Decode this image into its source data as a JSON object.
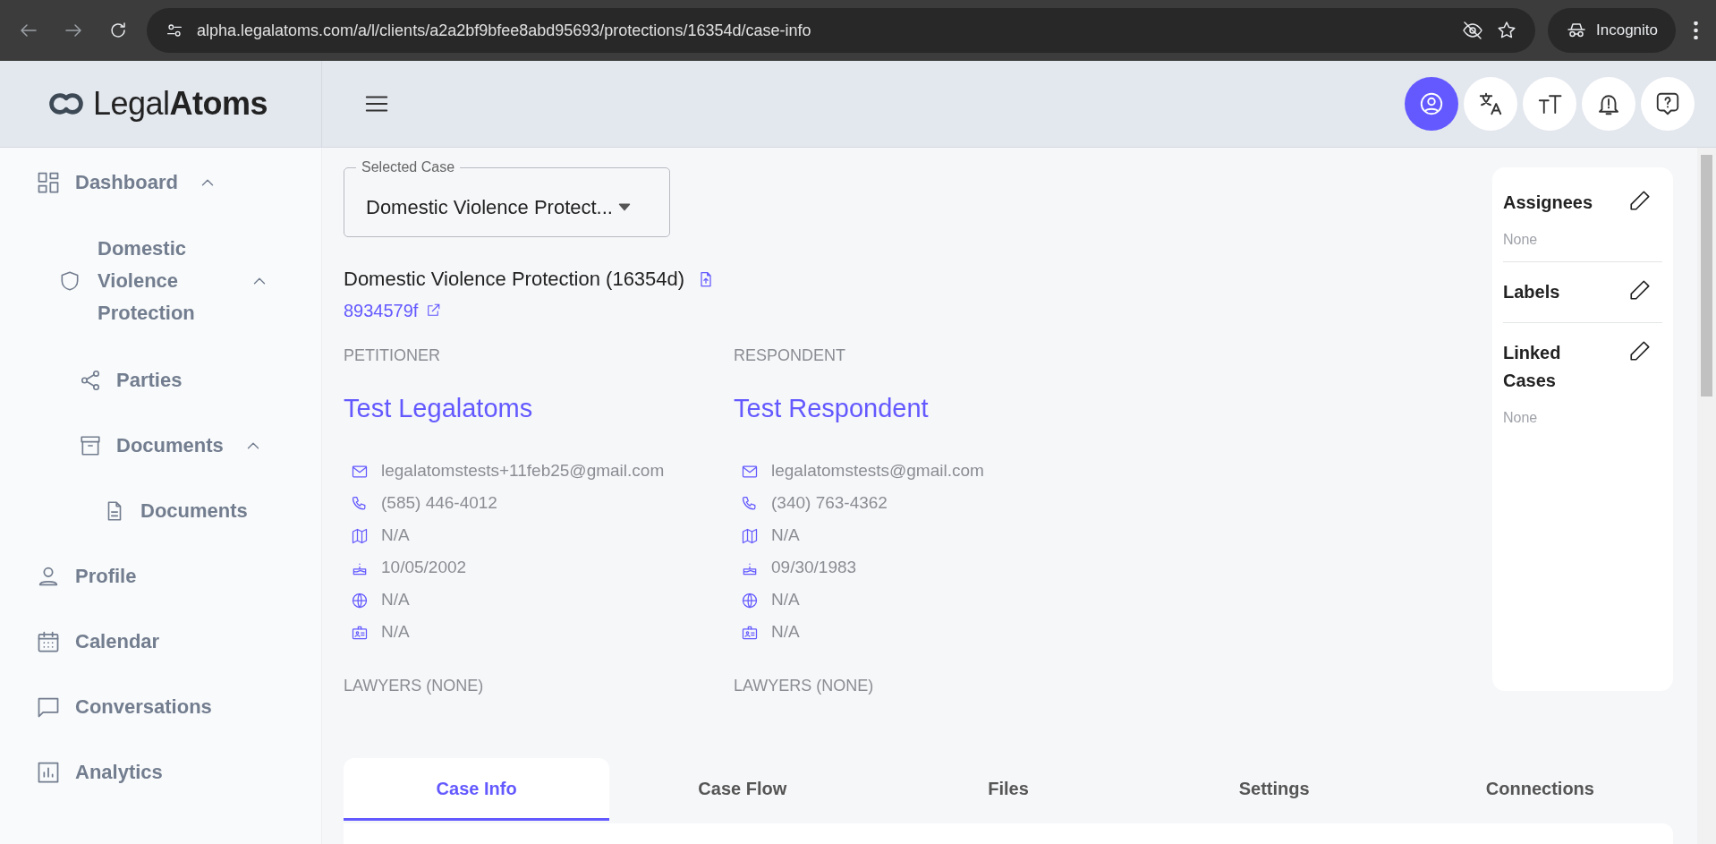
{
  "browser": {
    "url": "alpha.legalatoms.com/a/l/clients/a2a2bf9bfee8abd95693/protections/16354d/case-info",
    "profile_label": "Incognito"
  },
  "logo": {
    "text_plain": "Legal",
    "text_bold": "Atoms"
  },
  "header_buttons": [
    {
      "kind": "account",
      "selected": true
    },
    {
      "kind": "translate",
      "selected": false
    },
    {
      "kind": "text-size",
      "selected": false
    },
    {
      "kind": "notifications",
      "selected": false
    },
    {
      "kind": "help",
      "selected": false
    }
  ],
  "sidebar": {
    "items": [
      {
        "label": "Dashboard",
        "kind": "dashboard",
        "expanded": true,
        "children": [
          {
            "label": "Domestic Violence Protection",
            "kind": "case",
            "expanded": true,
            "children": [
              {
                "label": "Parties",
                "kind": "parties"
              },
              {
                "label": "Documents",
                "kind": "archive",
                "expanded": true,
                "children": [
                  {
                    "label": "Documents",
                    "kind": "document"
                  }
                ]
              }
            ]
          }
        ]
      },
      {
        "label": "Profile",
        "kind": "profile"
      },
      {
        "label": "Calendar",
        "kind": "calendar"
      },
      {
        "label": "Conversations",
        "kind": "conversations"
      },
      {
        "label": "Analytics",
        "kind": "analytics"
      }
    ]
  },
  "case_select": {
    "label": "Selected Case",
    "value": "Domestic Violence Protect..."
  },
  "case": {
    "title": "Domestic Violence Protection (16354d)",
    "reference": "8934579f"
  },
  "parties": [
    {
      "role": "PETITIONER",
      "name": "Test Legalatoms",
      "contacts": [
        {
          "kind": "email",
          "value": "legalatomstests+11feb25@gmail.com"
        },
        {
          "kind": "phone",
          "value": "(585) 446-4012"
        },
        {
          "kind": "address",
          "value": "N/A"
        },
        {
          "kind": "birthday",
          "value": "10/05/2002"
        },
        {
          "kind": "language",
          "value": "N/A"
        },
        {
          "kind": "id",
          "value": "N/A"
        }
      ],
      "lawyers": "LAWYERS (NONE)"
    },
    {
      "role": "RESPONDENT",
      "name": "Test Respondent",
      "contacts": [
        {
          "kind": "email",
          "value": "legalatomstests@gmail.com"
        },
        {
          "kind": "phone",
          "value": "(340) 763-4362"
        },
        {
          "kind": "address",
          "value": "N/A"
        },
        {
          "kind": "birthday",
          "value": "09/30/1983"
        },
        {
          "kind": "language",
          "value": "N/A"
        },
        {
          "kind": "id",
          "value": "N/A"
        }
      ],
      "lawyers": "LAWYERS (NONE)"
    }
  ],
  "side_panel": {
    "sections": [
      {
        "title": "Assignees",
        "value": "None"
      },
      {
        "title": "Labels"
      },
      {
        "title": "Linked Cases",
        "value": "None"
      }
    ]
  },
  "tabs": [
    {
      "label": "Case Info",
      "selected": true
    },
    {
      "label": "Case Flow",
      "selected": false
    },
    {
      "label": "Files",
      "selected": false
    },
    {
      "label": "Settings",
      "selected": false
    },
    {
      "label": "Connections",
      "selected": false
    }
  ]
}
